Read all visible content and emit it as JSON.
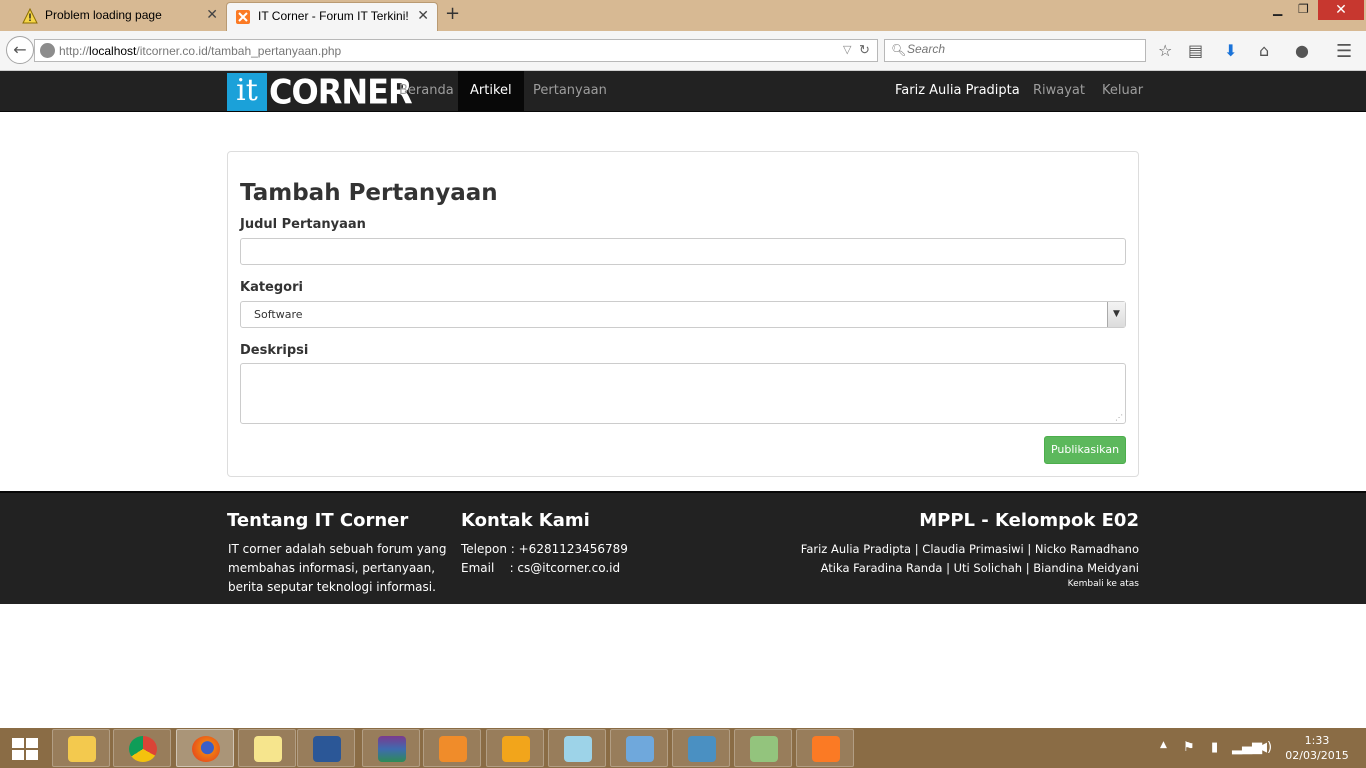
{
  "browser": {
    "tabs": [
      {
        "title": "Problem loading page",
        "icon": "warning-icon",
        "active": false
      },
      {
        "title": "IT Corner - Forum IT Terkini!",
        "icon": "xampp-icon",
        "active": true
      }
    ],
    "url_prefix": "http://",
    "url_host": "localhost",
    "url_path": "/itcorner.co.id/tambah_pertanyaan.php",
    "search_placeholder": "Search"
  },
  "site": {
    "logo_it": "it",
    "logo_corner": "CORNER",
    "nav": {
      "beranda": "Beranda",
      "artikel": "Artikel",
      "pertanyaan": "Pertanyaan",
      "user": "Fariz Aulia Pradipta",
      "riwayat": "Riwayat",
      "keluar": "Keluar"
    }
  },
  "form": {
    "title": "Tambah Pertanyaan",
    "judul_label": "Judul Pertanyaan",
    "judul_value": "",
    "kategori_label": "Kategori",
    "kategori_value": "Software",
    "deskripsi_label": "Deskripsi",
    "deskripsi_value": "",
    "submit_label": "Publikasikan"
  },
  "footer": {
    "about_title": "Tentang IT Corner",
    "about_text_1": "IT corner adalah sebuah forum yang",
    "about_text_2": "membahas informasi, pertanyaan,",
    "about_text_3": "berita seputar teknologi informasi.",
    "contact_title": "Kontak Kami",
    "phone": "Telepon : +6281123456789",
    "email_label": "Email",
    "email_value": ":  cs@itcorner.co.id",
    "team_title": "MPPL - Kelompok E02",
    "team_line_1": "Fariz Aulia Pradipta | Claudia Primasiwi | Nicko Ramadhano",
    "team_line_2": "Atika Faradina Randa | Uti Solichah | Biandina Meidyani",
    "back_to_top": "Kembali ke atas"
  },
  "taskbar": {
    "time": "1:33",
    "date": "02/03/2015",
    "apps": [
      "file-explorer-icon",
      "chrome-icon",
      "firefox-icon",
      "sticky-notes-icon",
      "word-icon",
      "winrar-icon",
      "media-player-icon",
      "music-icon",
      "notepad-icon",
      "paint-icon",
      "photo-viewer-icon",
      "notepadpp-icon",
      "xampp-icon"
    ]
  },
  "colors": {
    "tabbar": "#d7b993",
    "header": "#222222",
    "logo_blue": "#1ba1d9",
    "publish_green": "#5cb85c",
    "taskbar": "#8a6c45"
  }
}
